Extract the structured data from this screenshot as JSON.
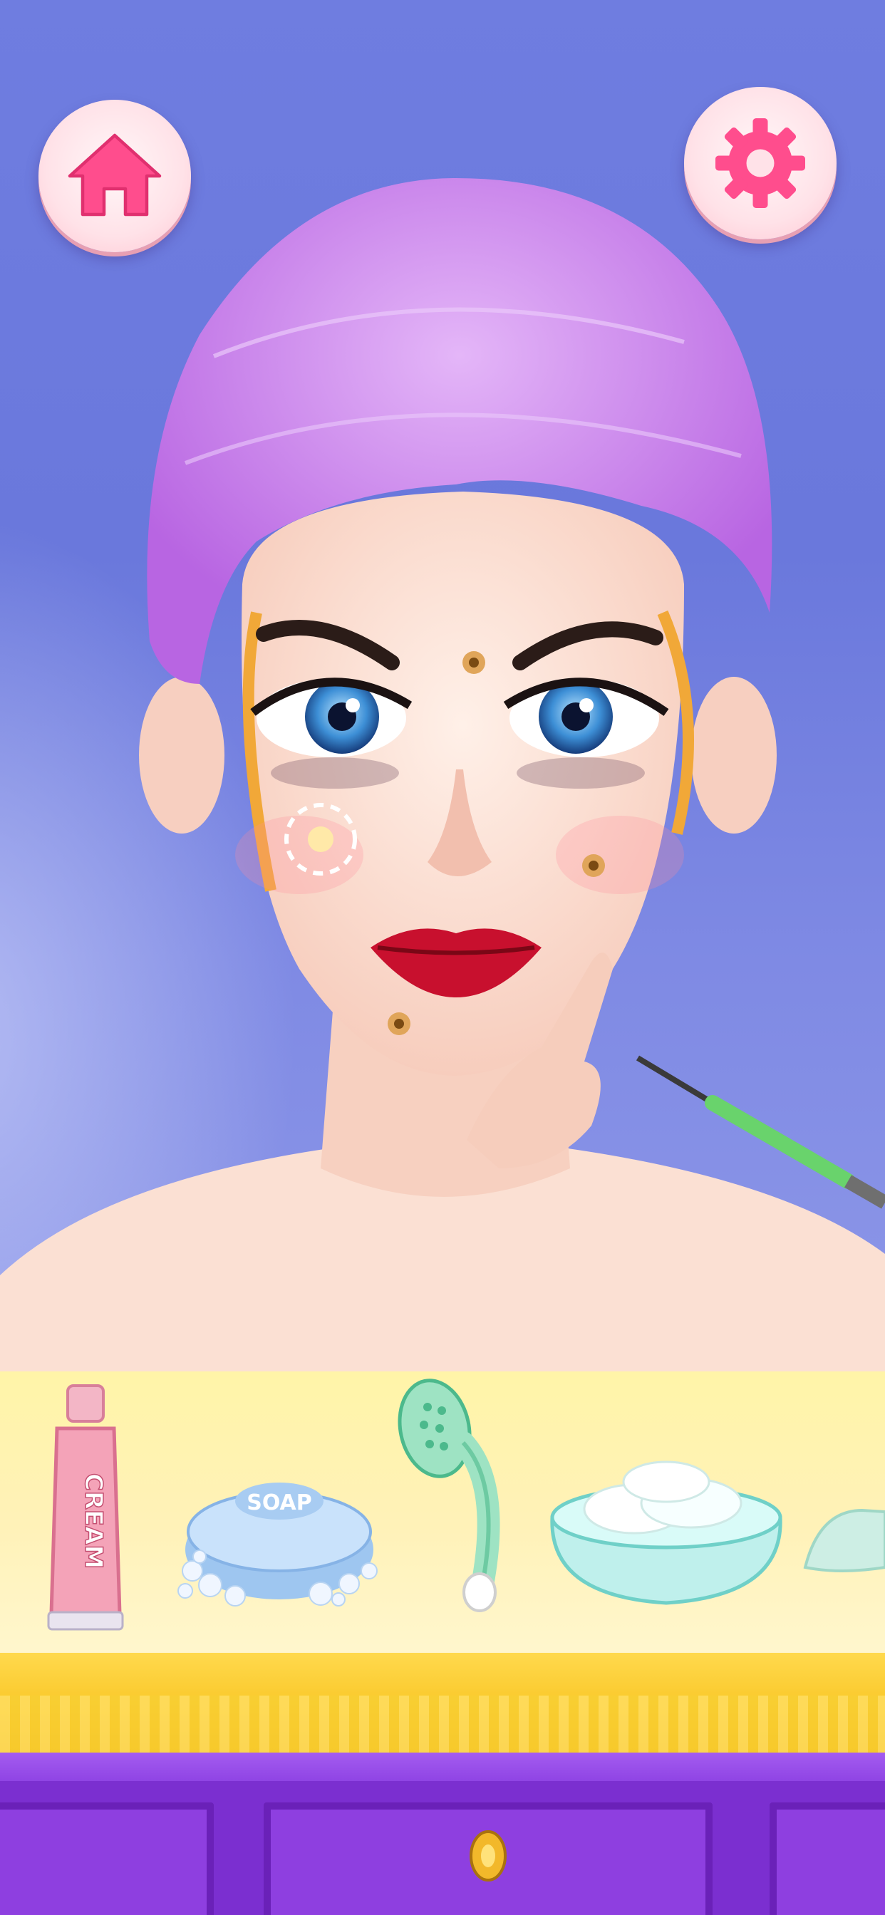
{
  "scene": {
    "colors": {
      "background": "#6f7de0",
      "towel": "#c77be8",
      "skin": "#fde3d6",
      "counter": "#fff2b8",
      "cabinet": "#7b2fd0",
      "button": "#ffe2e8",
      "button_icon": "#ff4d8d"
    }
  },
  "buttons": {
    "home": {
      "icon": "home-icon"
    },
    "settings": {
      "icon": "gear-icon"
    }
  },
  "tray": {
    "items": [
      {
        "name": "cream-tube",
        "text": "CREAM"
      },
      {
        "name": "soap-bar",
        "text": "SOAP"
      },
      {
        "name": "scrub-brush",
        "text": ""
      },
      {
        "name": "cotton-pad-bowl",
        "text": ""
      },
      {
        "name": "face-mask-strip",
        "text": ""
      }
    ]
  }
}
